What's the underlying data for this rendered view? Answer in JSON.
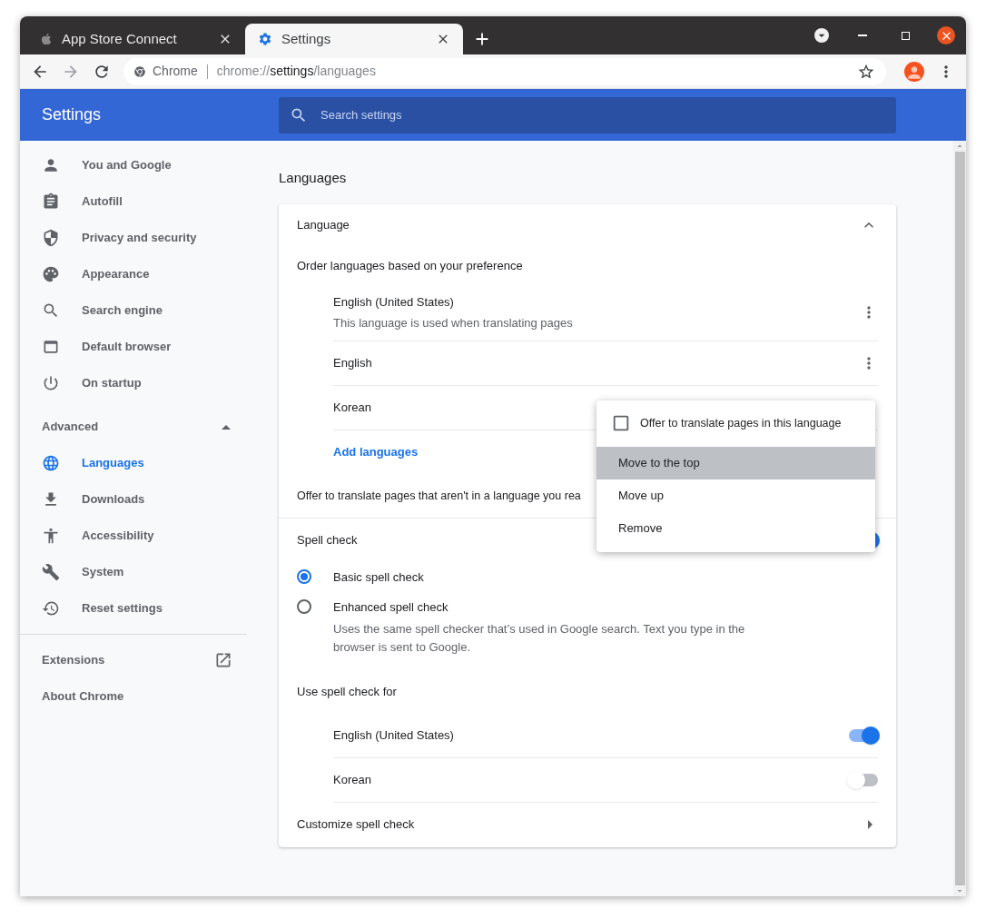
{
  "browser": {
    "tabs": [
      {
        "title": "App Store Connect",
        "selected": false
      },
      {
        "title": "Settings",
        "selected": true
      }
    ],
    "address": {
      "site": "Chrome",
      "url_scheme": "chrome://",
      "url_host": "settings",
      "url_path": "/languages"
    }
  },
  "header": {
    "title": "Settings",
    "search": {
      "placeholder": "Search settings"
    }
  },
  "sidebar": {
    "items": [
      {
        "label": "You and Google",
        "selected": false
      },
      {
        "label": "Autofill",
        "selected": false
      },
      {
        "label": "Privacy and security",
        "selected": false
      },
      {
        "label": "Appearance",
        "selected": false
      },
      {
        "label": "Search engine",
        "selected": false
      },
      {
        "label": "Default browser",
        "selected": false
      },
      {
        "label": "On startup",
        "selected": false
      }
    ],
    "advanced": {
      "label": "Advanced",
      "expanded": true,
      "items": [
        {
          "label": "Languages",
          "selected": true
        },
        {
          "label": "Downloads",
          "selected": false
        },
        {
          "label": "Accessibility",
          "selected": false
        },
        {
          "label": "System",
          "selected": false
        },
        {
          "label": "Reset settings",
          "selected": false
        }
      ]
    },
    "links": [
      {
        "label": "Extensions",
        "external": true
      },
      {
        "label": "About Chrome",
        "external": false
      }
    ]
  },
  "page": {
    "title": "Languages",
    "language": {
      "title": "Language",
      "expanded": true,
      "subtitle": "Order languages based on your preference",
      "languages": [
        {
          "name": "English (United States)",
          "description": "This language is used when translating pages"
        },
        {
          "name": "English"
        },
        {
          "name": "Korean"
        }
      ],
      "add_link": "Add languages",
      "offer_translate": "Offer to translate pages that aren't in a language you rea"
    },
    "spell_check": {
      "title": "Spell check",
      "on": true,
      "options": [
        {
          "label": "Basic spell check",
          "selected": true
        },
        {
          "label": "Enhanced spell check",
          "description": "Uses the same spell checker that’s used in Google search. Text you type in the browser is sent to Google.",
          "selected": false
        }
      ],
      "use_for_title": "Use spell check for",
      "languages": [
        {
          "name": "English (United States)",
          "on": true
        },
        {
          "name": "Korean",
          "on": false
        }
      ],
      "customize": "Customize spell check"
    }
  },
  "menu": {
    "checkbox": {
      "label": "Offer to translate pages in this language",
      "checked": false
    },
    "items": [
      {
        "label": "Move to the top",
        "selected": true
      },
      {
        "label": "Move up",
        "selected": false
      },
      {
        "label": "Remove",
        "selected": false
      }
    ]
  }
}
